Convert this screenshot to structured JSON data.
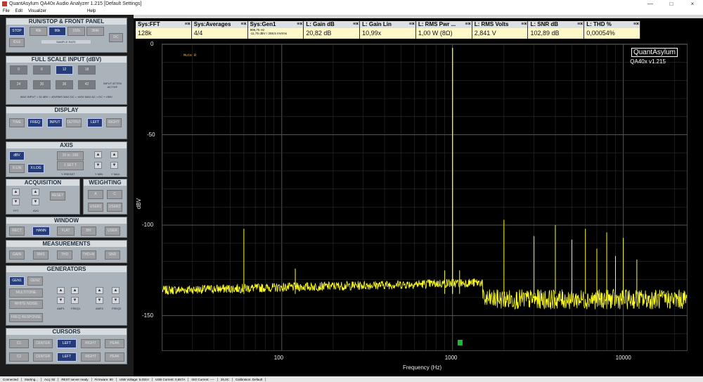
{
  "window": {
    "title": "QuantAsylum QA40x Audio Analyzer 1.215 [Default Settings]",
    "minimize": "—",
    "maximize": "□",
    "close": "×"
  },
  "menu": [
    "File",
    "Edit",
    "Visualizer",
    "Help"
  ],
  "panels": {
    "run": {
      "title": "RUN/STOP & FRONT PANEL",
      "stop": "STOP",
      "idle": "IDLE",
      "rates": [
        "48k",
        "96k",
        "192k",
        "384k"
      ],
      "dc": "DC",
      "sample_rate": "SAMPLE RATE"
    },
    "full_scale": {
      "title": "FULL SCALE INPUT (dBV)",
      "values": [
        "0",
        "6",
        "12",
        "18",
        "24",
        "30",
        "36",
        "42"
      ],
      "atten": "INPUT ATTEN ACTIVE",
      "warning": "MAX INPUT = 32 dBV = 40VRMS MAX DC = ±40V MAX AC = DC + ±56V"
    },
    "display": {
      "title": "DISPLAY",
      "items": [
        "TIME",
        "FREQ",
        "INPUT",
        "OUTPUT",
        "LEFT",
        "RIGHT"
      ]
    },
    "axis": {
      "title": "AXIS",
      "dbv": "dBV",
      "xlin": "X:LIN",
      "xlog": "X:LOG",
      "range": "20 to -160",
      "clear": "1 SET T",
      "preset": "Y PRESET",
      "ymin": "Y MIN",
      "ymax": "Y MAX"
    },
    "acquisition": {
      "title": "ACQUISITION",
      "fft": "FFT",
      "avg": "AVG",
      "reset": "RESET"
    },
    "weighting": {
      "title": "WEIGHTING",
      "items": [
        "A",
        "C",
        "USER1",
        "USER2"
      ]
    },
    "window": {
      "title": "WINDOW",
      "items": [
        "RECT",
        "HANN",
        "FLAT TOP",
        "BH",
        "USER"
      ]
    },
    "measurements": {
      "title": "MEASUREMENTS",
      "items": [
        "GAIN",
        "RMS",
        "THD",
        "THD+N",
        "SNR"
      ]
    },
    "generators": {
      "title": "GENERATORS",
      "gen1": "GEN1",
      "gen2": "GEN2",
      "multitone": "MULTITONE",
      "white_noise": "WHITE NOISE",
      "freq_response": "FREQ RESPONSE",
      "amp1": "AMP1",
      "freq1": "FREQ1",
      "amp2": "AMP2",
      "freq2": "FREQ2"
    },
    "cursors": {
      "title": "CURSORS",
      "c1": "C1",
      "c2": "C2",
      "center": "CENTER",
      "left": "LEFT",
      "right": "RIGHT",
      "peak": "PEAK"
    }
  },
  "measurements": [
    {
      "head": "Sys:FFT",
      "value": "128k"
    },
    {
      "head": "Sys:Averages",
      "value": "4/4"
    },
    {
      "head": "Sys:Gen1",
      "value": "999,75 Hz",
      "sub": "-11,75 dBV / 258,5 mVrms"
    },
    {
      "head": "L: Gain dB",
      "value": "20,82 dB"
    },
    {
      "head": "L: Gain Lin",
      "value": "10,99x"
    },
    {
      "head": "L: RMS Pwr ...",
      "value": "1,00 W (8Ω)"
    },
    {
      "head": "L: RMS Volts",
      "value": "2,841 V"
    },
    {
      "head": "L: SNR dB",
      "value": "102,89 dB"
    },
    {
      "head": "L: THD %",
      "value": "0,00054%"
    }
  ],
  "plot": {
    "brand": "QuantAsylum",
    "version": "QA40x v1.215",
    "mute": "Mute R",
    "yaxis": "dBV",
    "xaxis": "Frequency (Hz)"
  },
  "chart_data": {
    "type": "line",
    "xlabel": "Frequency (Hz)",
    "ylabel": "dBV",
    "xscale": "log",
    "xlim": [
      20,
      24000
    ],
    "ylim": [
      -170,
      0
    ],
    "x_ticks": [
      100,
      1000,
      10000
    ],
    "y_ticks": [
      0,
      -50,
      -100,
      -150
    ],
    "series": [
      {
        "color": "#ffff22",
        "points": [
          [
            20,
            -136
          ],
          [
            30,
            -135
          ],
          [
            50,
            -133
          ],
          [
            60,
            -102
          ],
          [
            70,
            -132
          ],
          [
            100,
            -134
          ],
          [
            120,
            -124
          ],
          [
            150,
            -132
          ],
          [
            200,
            -132
          ],
          [
            300,
            -128
          ],
          [
            500,
            -132
          ],
          [
            700,
            -130
          ],
          [
            900,
            -125
          ],
          [
            1000,
            -2
          ],
          [
            1100,
            -125
          ],
          [
            1500,
            -136
          ],
          [
            2000,
            -97
          ],
          [
            3000,
            -106
          ],
          [
            4000,
            -100
          ],
          [
            5000,
            -108
          ],
          [
            6000,
            -102
          ],
          [
            7000,
            -113
          ],
          [
            8000,
            -104
          ],
          [
            9000,
            -117
          ],
          [
            10000,
            -107
          ],
          [
            12000,
            -119
          ],
          [
            15000,
            -139
          ],
          [
            20000,
            -138
          ],
          [
            24000,
            -138
          ]
        ]
      }
    ],
    "grid": true
  },
  "status": [
    "Connected",
    "Starting...",
    "Acq: 92",
    "REST server ready",
    "Firmware: 80",
    "USB Voltage: 5,031V",
    "USB Current: 0,657A",
    "ISO Current: ----",
    "25,0C",
    "Calibration: Default"
  ]
}
